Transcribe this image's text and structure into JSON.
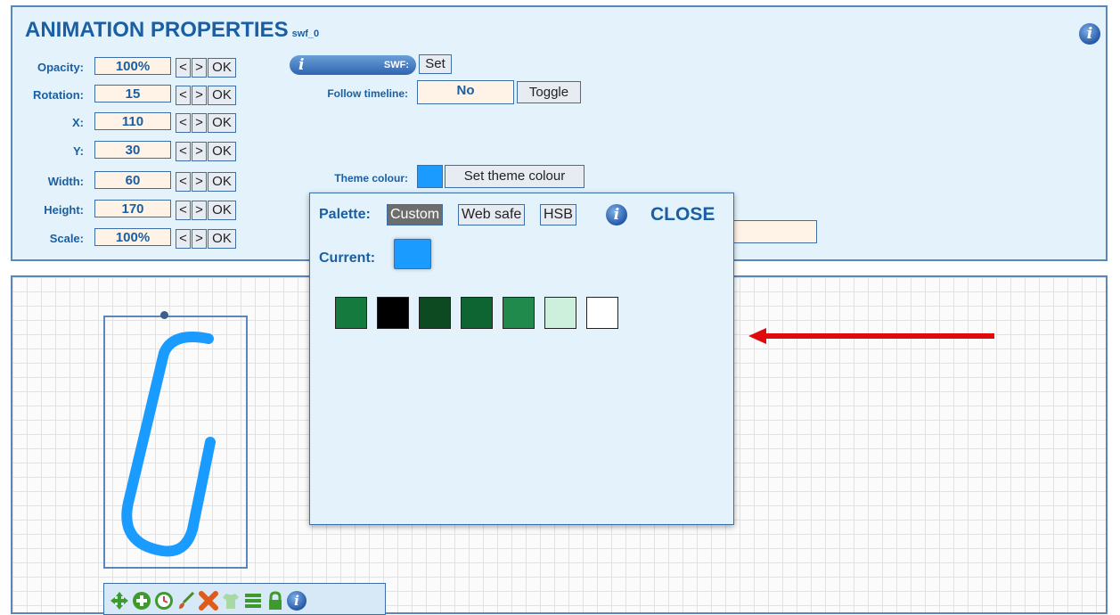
{
  "props": {
    "title": "ANIMATION PROPERTIES",
    "subtitle": "swf_0",
    "rows": [
      {
        "label": "Opacity:",
        "value": "100%"
      },
      {
        "label": "Rotation:",
        "value": "15"
      },
      {
        "label": "X:",
        "value": "110"
      },
      {
        "label": "Y:",
        "value": "30"
      },
      {
        "label": "Width:",
        "value": "60"
      },
      {
        "label": "Height:",
        "value": "170"
      },
      {
        "label": "Scale:",
        "value": "100%"
      }
    ],
    "prev_label": "<",
    "next_label": ">",
    "ok_label": "OK",
    "swf_label": "SWF:",
    "info_glyph": "i",
    "set_label": "Set",
    "follow_label": "Follow timeline:",
    "follow_value": "No",
    "toggle_label": "Toggle",
    "theme_label": "Theme colour:",
    "theme_color": "#1a9bff",
    "set_theme_label": "Set theme colour"
  },
  "palette": {
    "palette_label": "Palette:",
    "tabs": [
      "Custom",
      "Web safe",
      "HSB"
    ],
    "active_tab": "Custom",
    "close_label": "CLOSE",
    "current_label": "Current:",
    "current_color": "#1a9bff",
    "swatches": [
      "#157a3e",
      "#000000",
      "#0d4a22",
      "#0f6531",
      "#1f8a4c",
      "#ccf0dc",
      "#ffffff"
    ]
  },
  "colors": {
    "accent": "#1a5fa3",
    "shape_stroke": "#1a9bff",
    "arrow": "#e0090b"
  },
  "toolbar": {
    "icons": [
      "move-icon",
      "add-icon",
      "clock-icon",
      "brush-icon",
      "delete-icon",
      "shirt-icon",
      "menu-icon",
      "lock-icon",
      "info-icon"
    ]
  }
}
